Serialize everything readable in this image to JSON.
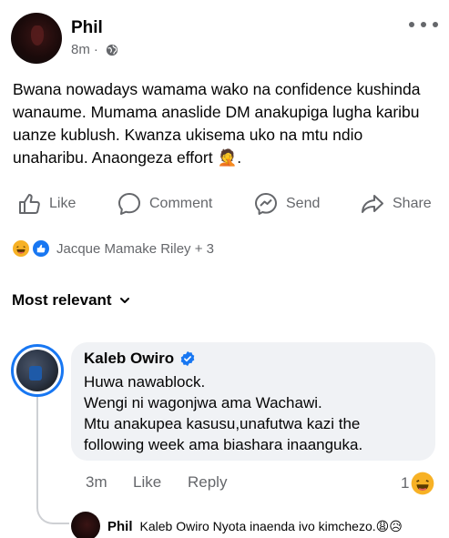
{
  "post": {
    "author": "Phil",
    "time": "8m",
    "text": "Bwana nowadays wamama wako na confidence kushinda wanaume. Mumama anaslide DM anakupiga lugha karibu uanze kublush. Kwanza ukisema uko na mtu ndio unaharibu. Anaongeza effort 🤦.",
    "actions": {
      "like": "Like",
      "comment": "Comment",
      "send": "Send",
      "share": "Share"
    },
    "reactions_text": "Jacque Mamake Riley + 3"
  },
  "comments_sort": "Most relevant",
  "comment": {
    "author": "Kaleb Owiro",
    "lines": [
      "Huwa nawablock.",
      "Wengi ni wagonjwa ama Wachawi.",
      "Mtu anakupea kasusu,unafutwa kazi the",
      "following week ama biashara inaanguka."
    ],
    "time": "3m",
    "like": "Like",
    "reply": "Reply",
    "reaction_count": "1"
  },
  "reply": {
    "author": "Phil",
    "text": "Kaleb Owiro Nyota inaenda ivo kimchezo.😩😥"
  },
  "colors": {
    "accent": "#1877f2",
    "muted": "#65676b",
    "bubble": "#f0f2f5"
  }
}
